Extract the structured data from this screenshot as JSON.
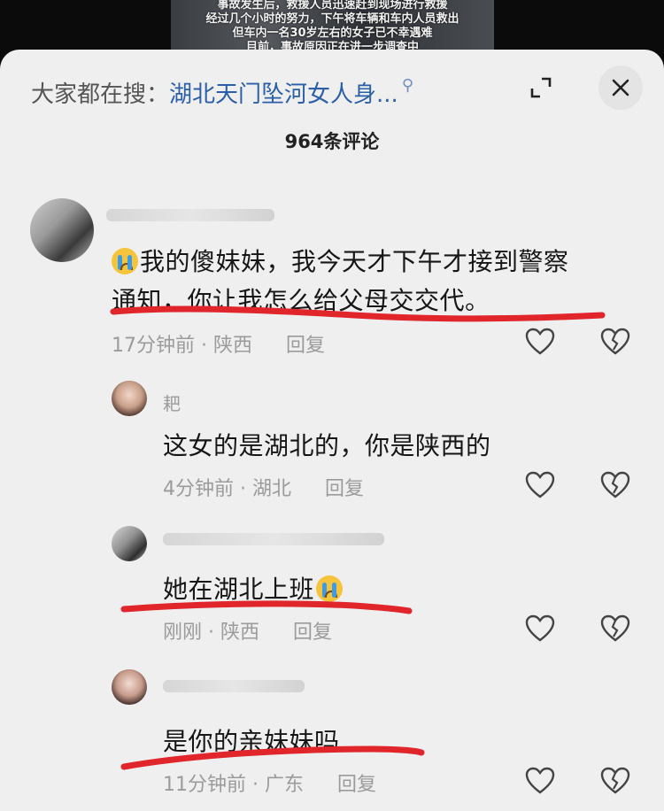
{
  "video_caption": {
    "line1": "事故发生后，救援人员迅速赶到现场进行救援",
    "line2": "经过几个小时的努力，下午将车辆和车内人员救出",
    "line3": "但车内一名30岁左右的女子已不幸遇难",
    "line4": "目前，事故原因正在进一步调查中"
  },
  "search": {
    "prefix": "大家都在搜：",
    "keyword": "湖北天门坠河女人身..."
  },
  "comment_count": "964条评论",
  "comments": [
    {
      "text_after_emoji": "我的傻妹妹，我今天才下午才接到警察",
      "text_line2": "通知，你让我怎么给父母交交代。",
      "time_loc": "17分钟前 · 陕西",
      "reply": "回复"
    },
    {
      "name": "耙",
      "text": "这女的是湖北的，你是陕西的",
      "time_loc": "4分钟前 · 湖北",
      "reply": "回复"
    },
    {
      "text": "她在湖北上班",
      "time_loc": "刚刚 · 陕西",
      "reply": "回复"
    },
    {
      "text": "是你的亲妹妹吗",
      "time_loc": "11分钟前 · 广东",
      "reply": "回复"
    }
  ],
  "colors": {
    "keyword": "#2b5fa8",
    "underline": "#e0252b",
    "sheet": "#efefef"
  }
}
